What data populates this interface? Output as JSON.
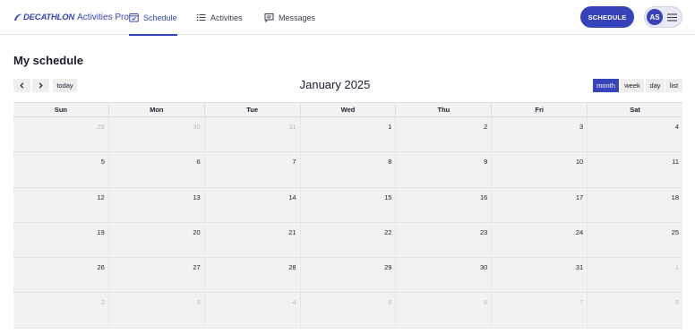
{
  "header": {
    "brand_name": "DECATHLON",
    "brand_suffix": "Activities Pro",
    "nav": [
      {
        "label": "Schedule",
        "icon": "calendar-icon",
        "active": true
      },
      {
        "label": "Activities",
        "icon": "list-icon",
        "active": false
      },
      {
        "label": "Messages",
        "icon": "chat-icon",
        "active": false
      }
    ],
    "cta_label": "SCHEDULE",
    "user_initials": "AS"
  },
  "page": {
    "title": "My schedule"
  },
  "toolbar": {
    "today_label": "today",
    "title": "January 2025",
    "views": [
      "month",
      "week",
      "day",
      "list"
    ],
    "active_view": "month"
  },
  "calendar": {
    "weekdays": [
      "Sun",
      "Mon",
      "Tue",
      "Wed",
      "Thu",
      "Fri",
      "Sat"
    ],
    "weeks": [
      [
        {
          "d": "29",
          "o": true
        },
        {
          "d": "30",
          "o": true
        },
        {
          "d": "31",
          "o": true
        },
        {
          "d": "1"
        },
        {
          "d": "2"
        },
        {
          "d": "3"
        },
        {
          "d": "4"
        }
      ],
      [
        {
          "d": "5"
        },
        {
          "d": "6"
        },
        {
          "d": "7"
        },
        {
          "d": "8"
        },
        {
          "d": "9"
        },
        {
          "d": "10"
        },
        {
          "d": "11"
        }
      ],
      [
        {
          "d": "12"
        },
        {
          "d": "13"
        },
        {
          "d": "14"
        },
        {
          "d": "15"
        },
        {
          "d": "16"
        },
        {
          "d": "17"
        },
        {
          "d": "18"
        }
      ],
      [
        {
          "d": "19"
        },
        {
          "d": "20"
        },
        {
          "d": "21"
        },
        {
          "d": "22"
        },
        {
          "d": "23"
        },
        {
          "d": "24"
        },
        {
          "d": "25"
        }
      ],
      [
        {
          "d": "26"
        },
        {
          "d": "27"
        },
        {
          "d": "28"
        },
        {
          "d": "29"
        },
        {
          "d": "30"
        },
        {
          "d": "31"
        },
        {
          "d": "1",
          "o": true
        }
      ],
      [
        {
          "d": "2",
          "o": true
        },
        {
          "d": "3",
          "o": true
        },
        {
          "d": "4",
          "o": true
        },
        {
          "d": "5",
          "o": true
        },
        {
          "d": "6",
          "o": true
        },
        {
          "d": "7",
          "o": true
        },
        {
          "d": "8",
          "o": true
        }
      ]
    ]
  },
  "colors": {
    "brand": "#3643ba",
    "cell_bg": "#f2f2f2",
    "other_month_text": "#bdbdbd"
  }
}
